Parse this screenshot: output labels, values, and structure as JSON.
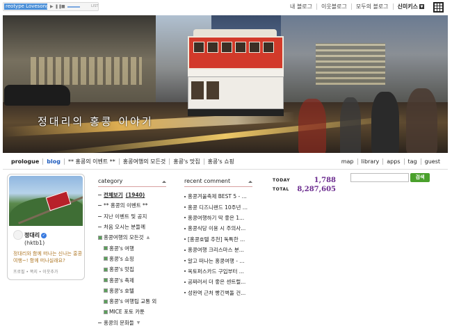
{
  "player": {
    "song": "reotype Lovesong (",
    "list_label": "LIST"
  },
  "top_links": [
    "내 블로그",
    "이웃블로그",
    "모두의 블로그"
  ],
  "user_menu": "신미키스",
  "blog_title": "정대리의 홍콩 이야기",
  "nav": {
    "left": [
      "prologue",
      "blog",
      "** 홍콩의 이벤트 **",
      "홍콩여행의 모든것",
      "홍콩's 맛집",
      "홍콩's 쇼핑"
    ],
    "active": "blog",
    "right": [
      "map",
      "library",
      "apps",
      "tag",
      "guest"
    ]
  },
  "profile": {
    "name": "정대리",
    "id": "(hktb1)",
    "desc": "정대리와 함께 떠나는 신나는 홍콩여행~! 함께 떠나실래요?",
    "links": "프로필 • 쪽지 • 이웃추가"
  },
  "category": {
    "title": "category",
    "items": [
      {
        "label": "전체보기",
        "count": "(1940)",
        "type": "top"
      },
      {
        "label": "** 홍콩의 이벤트 **",
        "type": "plain"
      },
      {
        "label": "지난 이벤트 및 공지",
        "type": "plain"
      },
      {
        "label": "처음 오시는 분들께",
        "type": "plain"
      },
      {
        "label": "홍콩여행의 모든것",
        "type": "group"
      },
      {
        "label": "홍콩's 여행",
        "type": "sub"
      },
      {
        "label": "홍콩's 쇼핑",
        "type": "sub"
      },
      {
        "label": "홍콩's 맛집",
        "type": "sub"
      },
      {
        "label": "홍콩's 축제",
        "type": "sub"
      },
      {
        "label": "홍콩's 호텔",
        "type": "sub"
      },
      {
        "label": "홍콩's 여행팁 교통 외",
        "type": "sub"
      },
      {
        "label": "MICE 포토 카툰",
        "type": "sub"
      },
      {
        "label": "홍콩의 문화들",
        "type": "group"
      }
    ]
  },
  "recent_comment": {
    "title": "recent comment",
    "items": [
      "홍콩겨울축제 BEST 5 - ...",
      "홍콩 디즈니랜드 10주년 ...",
      "홍콩여행하기 딱 좋은 1...",
      "홍콩식당 이용 시 주의사...",
      "[홍콩호텔 추천] 독특한 ...",
      "홍콩여행 크리스마스 분...",
      "알고 떠나는 홍콩여행 - ...",
      "옥토퍼스카드 구입부터 ...",
      "공짜러서 더 좋은 센트럴...",
      "성완역 근처 빵긴벽돌 건..."
    ]
  },
  "stats": {
    "today_label": "TODAY",
    "today": "1,788",
    "total_label": "TOTAL",
    "total": "8,287,605"
  },
  "search": {
    "placeholder": "",
    "button": "검색"
  }
}
